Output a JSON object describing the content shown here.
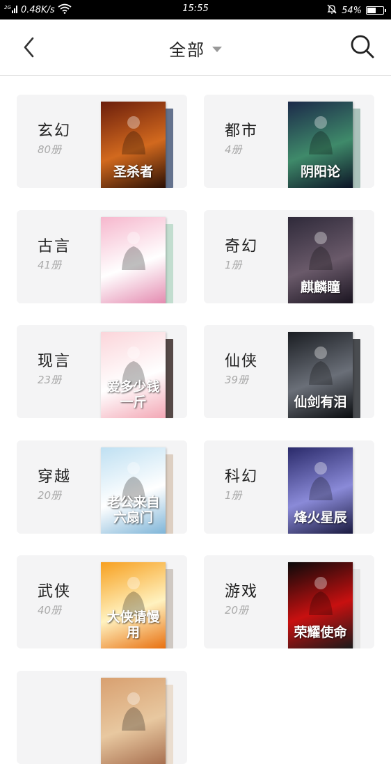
{
  "status_bar": {
    "network_speed": "0.48K/s",
    "time": "15:55",
    "battery": "54%",
    "battery_level": 0.54
  },
  "header": {
    "title": "全部"
  },
  "categories": [
    {
      "name": "玄幻",
      "count": "80册",
      "cover_title": "圣杀者",
      "cover_colors": [
        "#6b1e0c",
        "#d2691e",
        "#2b1005"
      ],
      "back_color": "#4a5a7a"
    },
    {
      "name": "都市",
      "count": "4册",
      "cover_title": "阴阳论",
      "cover_colors": [
        "#1c2a4a",
        "#3f8a6a",
        "#0c1426"
      ],
      "back_color": "#9db8b0"
    },
    {
      "name": "古言",
      "count": "41册",
      "cover_title": "",
      "cover_colors": [
        "#f6b7cd",
        "#ffffff",
        "#e48bb0"
      ],
      "back_color": "#b8d8c8"
    },
    {
      "name": "奇幻",
      "count": "1册",
      "cover_title": "麒麟瞳",
      "cover_colors": [
        "#2f2a3a",
        "#6a5a6a",
        "#1a1420"
      ],
      "back_color": "#f4f4f5"
    },
    {
      "name": "现言",
      "count": "23册",
      "cover_title": "爱多少钱一斤",
      "cover_colors": [
        "#fbd5da",
        "#ffffff",
        "#f3a7b5"
      ],
      "back_color": "#3a2a28"
    },
    {
      "name": "仙侠",
      "count": "39册",
      "cover_title": "仙剑有泪",
      "cover_colors": [
        "#1a1d22",
        "#6a6f78",
        "#0a0c0f"
      ],
      "back_color": "#2a2e33"
    },
    {
      "name": "穿越",
      "count": "20册",
      "cover_title": "老公来自六扇门",
      "cover_colors": [
        "#bfe0f2",
        "#ffffff",
        "#7fb5d8"
      ],
      "back_color": "#d8c8b8"
    },
    {
      "name": "科幻",
      "count": "1册",
      "cover_title": "烽火星辰",
      "cover_colors": [
        "#2a2a6a",
        "#8a8ad8",
        "#1a1a40"
      ],
      "back_color": "#f4f4f5"
    },
    {
      "name": "武侠",
      "count": "40册",
      "cover_title": "大侠请慢用",
      "cover_colors": [
        "#f7a020",
        "#fff2c0",
        "#e87010"
      ],
      "back_color": "#c8c0b8"
    },
    {
      "name": "游戏",
      "count": "20册",
      "cover_title": "荣耀使命",
      "cover_colors": [
        "#0a0a0a",
        "#c81010",
        "#1a1a1a"
      ],
      "back_color": "#e0e0e0"
    },
    {
      "name": "",
      "count": "",
      "cover_title": "",
      "cover_colors": [
        "#d8a070",
        "#e8c8a0",
        "#a87050"
      ],
      "back_color": "#e8d8c8"
    }
  ]
}
